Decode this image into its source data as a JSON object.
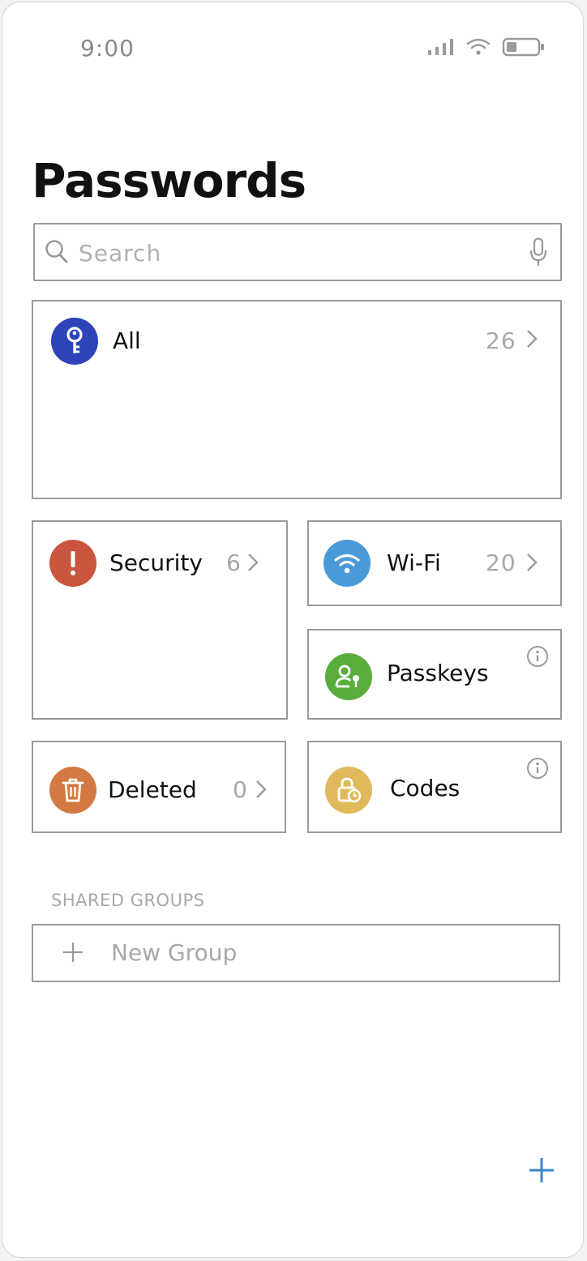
{
  "status_bar": {
    "time": "9:00"
  },
  "header": {
    "title": "Passwords"
  },
  "search": {
    "placeholder": "Search"
  },
  "categories": {
    "all": {
      "label": "All",
      "count": "26",
      "icon": "key-icon",
      "color": "#2c44b8"
    },
    "security": {
      "label": "Security",
      "count": "6",
      "icon": "exclamation-icon",
      "color": "#c9553f"
    },
    "wifi": {
      "label": "Wi-Fi",
      "count": "20",
      "icon": "wifi-icon",
      "color": "#4a9ad8"
    },
    "passkeys": {
      "label": "Passkeys",
      "icon": "person-key-icon",
      "color": "#5aad3c"
    },
    "deleted": {
      "label": "Deleted",
      "count": "0",
      "icon": "trash-icon",
      "color": "#d37a44"
    },
    "codes": {
      "label": "Codes",
      "icon": "lock-clock-icon",
      "color": "#e0b95a"
    }
  },
  "shared_groups": {
    "section_label": "SHARED GROUPS",
    "new_group_label": "New Group"
  },
  "colors": {
    "accent": "#3d86c6",
    "muted_text": "#a8a8a8",
    "border": "#9a9a9a"
  }
}
